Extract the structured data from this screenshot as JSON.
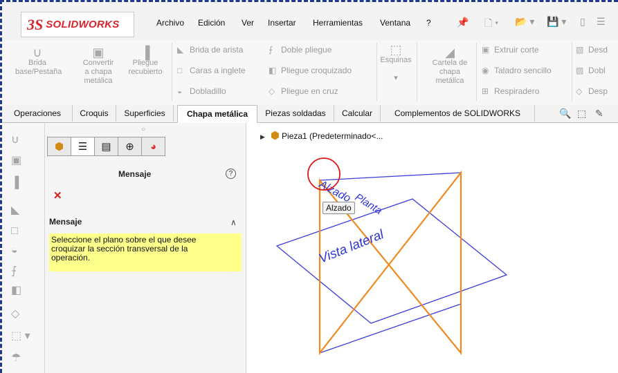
{
  "menu": {
    "items": [
      "Archivo",
      "Edición",
      "Ver",
      "Insertar",
      "Herramientas",
      "Ventana",
      "?"
    ],
    "logo_prefix": "3S",
    "logo_text": "SOLIDWORKS"
  },
  "ribbon": {
    "big": [
      {
        "label1": "Brida",
        "label2": "base/Pestaña",
        "label3": "",
        "icon": "base-flange-icon"
      },
      {
        "label1": "Convertir",
        "label2": "a chapa",
        "label3": "metálica",
        "icon": "convert-sheet-icon"
      },
      {
        "label1": "Pliegue",
        "label2": "recubierto",
        "label3": "",
        "icon": "lofted-bend-icon"
      },
      {
        "label1": "Esquinas",
        "label2": "",
        "label3": "",
        "icon": "corners-icon"
      },
      {
        "label1": "Cartela de",
        "label2": "chapa",
        "label3": "metálica",
        "icon": "gusset-icon"
      }
    ],
    "small": [
      "Brida de arista",
      "Caras a inglete",
      "Dobladillo",
      "Doble pliegue",
      "Pliegue croquizado",
      "Pliegue en cruz",
      "Extruir corte",
      "Taladro sencillo",
      "Respiradero",
      "Desd",
      "Dobl",
      "Desp"
    ]
  },
  "tabs": [
    "Operaciones",
    "Croquis",
    "Superficies",
    "Chapa metálica",
    "Piezas soldadas",
    "Calcular",
    "Complementos de SOLIDWORKS"
  ],
  "active_tab": "Chapa metálica",
  "property_manager": {
    "title": "Mensaje",
    "group_title": "Mensaje",
    "message": "Seleccione el plano sobre el que desee croquizar la sección transversal de la operación.",
    "message_line1": "Seleccione el plano sobre el que desee",
    "message_line2": "croquizar la sección transversal de la",
    "message_line3": "operación."
  },
  "feature_tree": {
    "root": "Pieza1  (Predeterminado<..."
  },
  "viewport": {
    "plane_labels": [
      "Alzado",
      "Planta",
      "Vista lateral"
    ],
    "tooltip": "Alzado"
  },
  "colors": {
    "accent": "#1f3a8a",
    "plane_front": "#f08a1c",
    "plane_other": "#3b3bdc",
    "message_bg": "#ffff8c",
    "brand_red": "#d9232d"
  }
}
